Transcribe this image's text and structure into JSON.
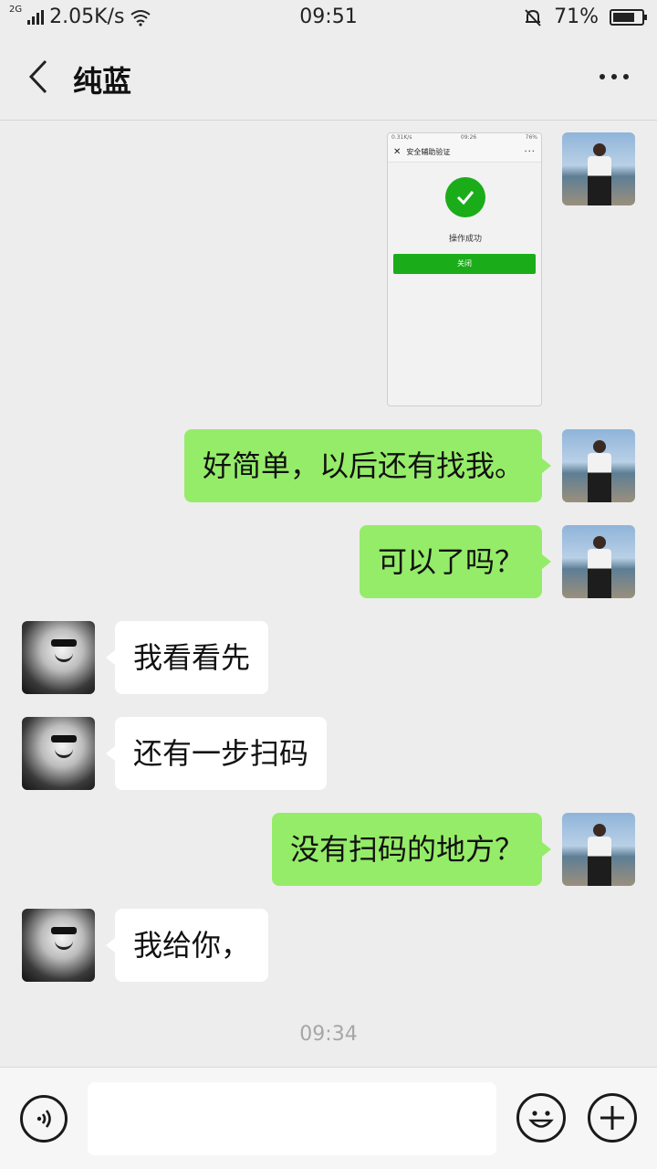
{
  "status_bar": {
    "network_type": "2G",
    "speed": "2.05K/s",
    "time": "09:51",
    "battery": "71%",
    "battery_level": 0.71
  },
  "header": {
    "title": "纯蓝"
  },
  "messages": [
    {
      "sender": "self",
      "type": "image"
    },
    {
      "sender": "self",
      "text": "好简单，以后还有找我。"
    },
    {
      "sender": "self",
      "text": "可以了吗？"
    },
    {
      "sender": "other",
      "text": "我看看先"
    },
    {
      "sender": "other",
      "text": "还有一步扫码"
    },
    {
      "sender": "self",
      "text": "没有扫码的地方？"
    },
    {
      "sender": "other",
      "text": "我给你，"
    }
  ],
  "image_message": {
    "status_left": "0.31K/s",
    "status_time": "09:26",
    "status_right": "76%",
    "page_title": "安全辅助验证",
    "success_text": "操作成功",
    "close_button": "关闭"
  },
  "timestamp": "09:34",
  "input_bar": {
    "value": "",
    "placeholder": ""
  },
  "colors": {
    "self_bubble": "#95ec69",
    "other_bubble": "#ffffff",
    "background": "#ededed",
    "success_green": "#1aad19"
  }
}
